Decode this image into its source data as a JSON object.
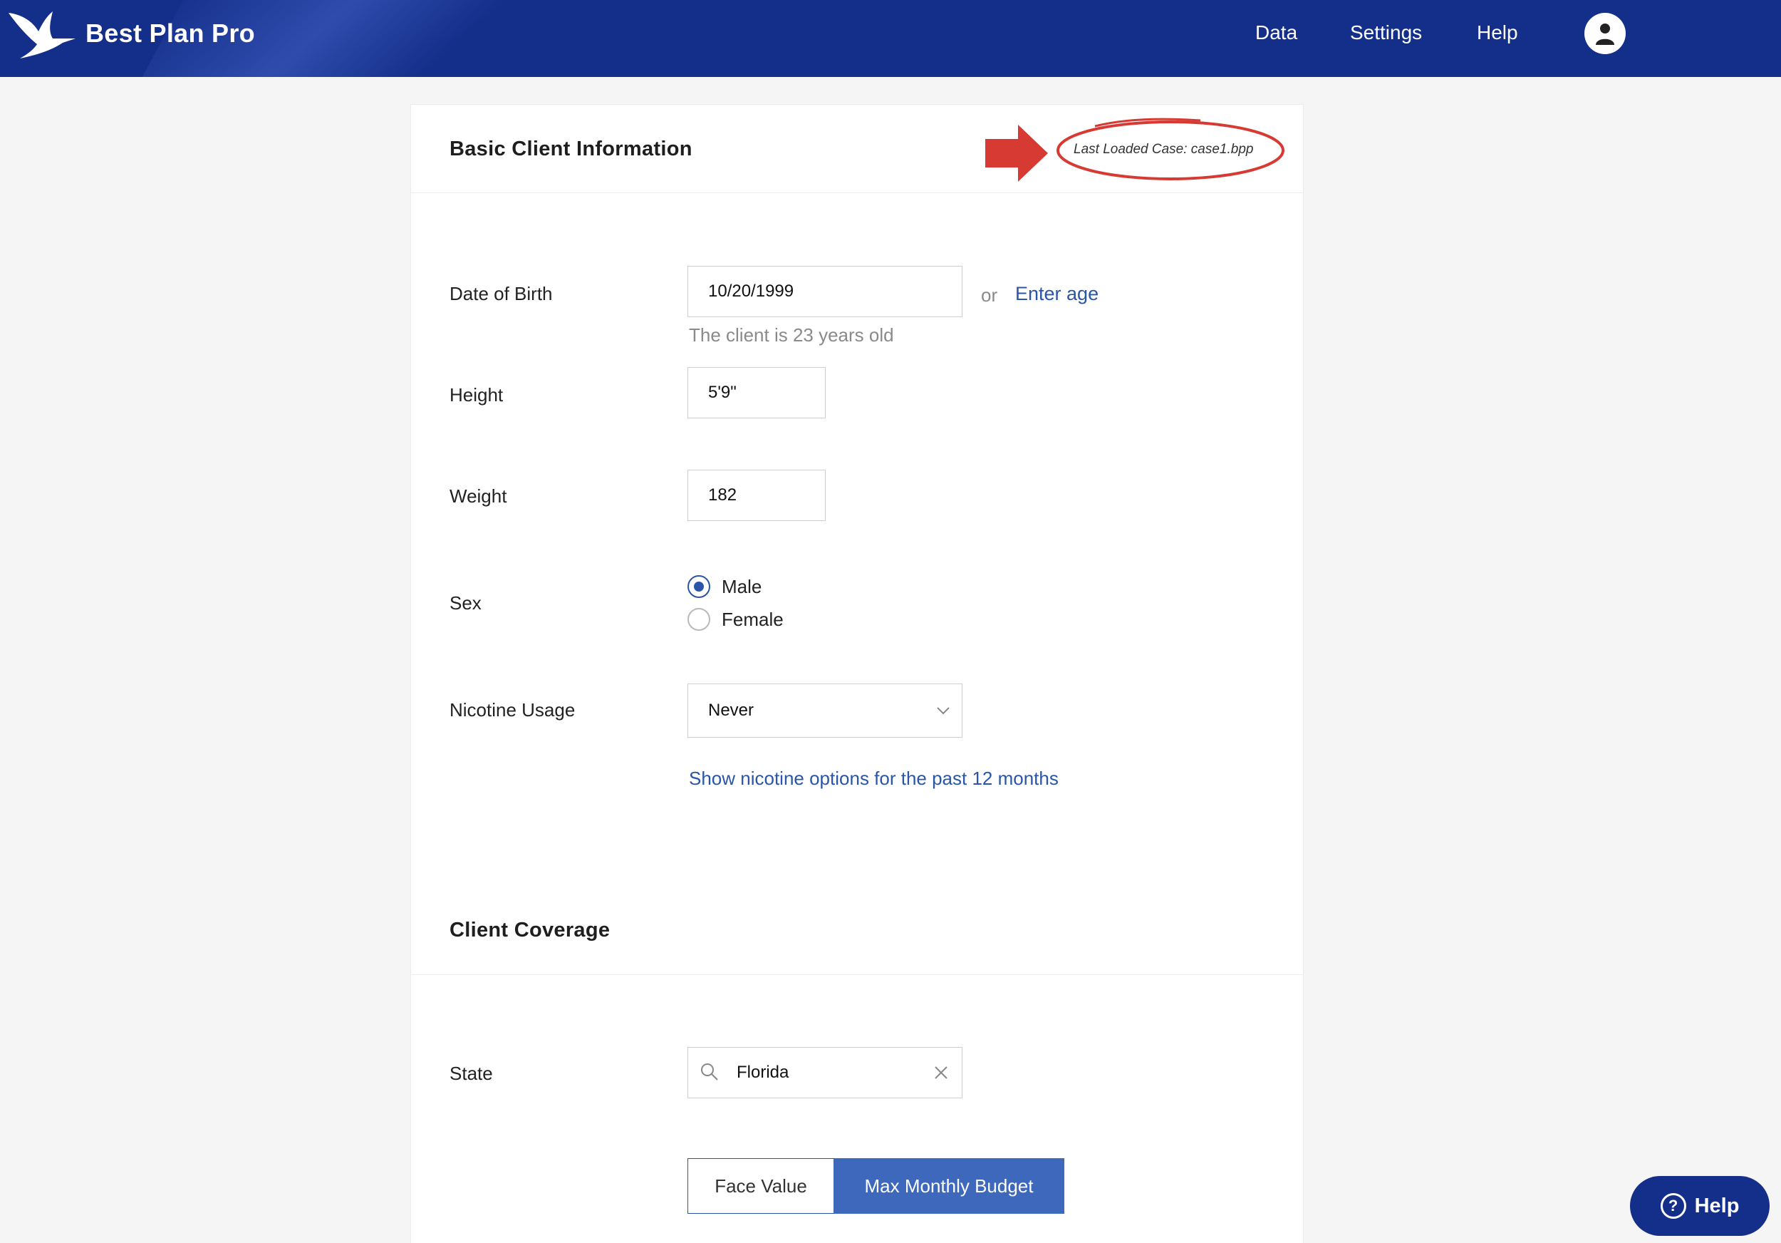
{
  "header": {
    "brand": "Best Plan Pro",
    "nav": [
      "Data",
      "Settings",
      "Help"
    ],
    "color": "#142f8a"
  },
  "basic_info": {
    "title": "Basic Client Information",
    "last_loaded_case": "Last Loaded Case: case1.bpp",
    "dob_label": "Date of Birth",
    "dob_value": "10/20/1999",
    "or_text": "or",
    "enter_age_link": "Enter age",
    "age_hint": "The client is 23 years old",
    "height_label": "Height",
    "height_value": "5'9\"",
    "weight_label": "Weight",
    "weight_value": "182",
    "sex_label": "Sex",
    "sex_options": [
      "Male",
      "Female"
    ],
    "sex_selected": "Male",
    "nicotine_label": "Nicotine Usage",
    "nicotine_value": "Never",
    "nicotine_link": "Show nicotine options for the past 12 months"
  },
  "coverage": {
    "title": "Client Coverage",
    "state_label": "State",
    "state_value": "Florida",
    "toggle_options": [
      "Face Value",
      "Max Monthly Budget"
    ],
    "toggle_selected": "Max Monthly Budget"
  },
  "help_fab": {
    "label": "Help"
  },
  "colors": {
    "accent": "#2a55a8",
    "annotation": "#d63a32"
  }
}
